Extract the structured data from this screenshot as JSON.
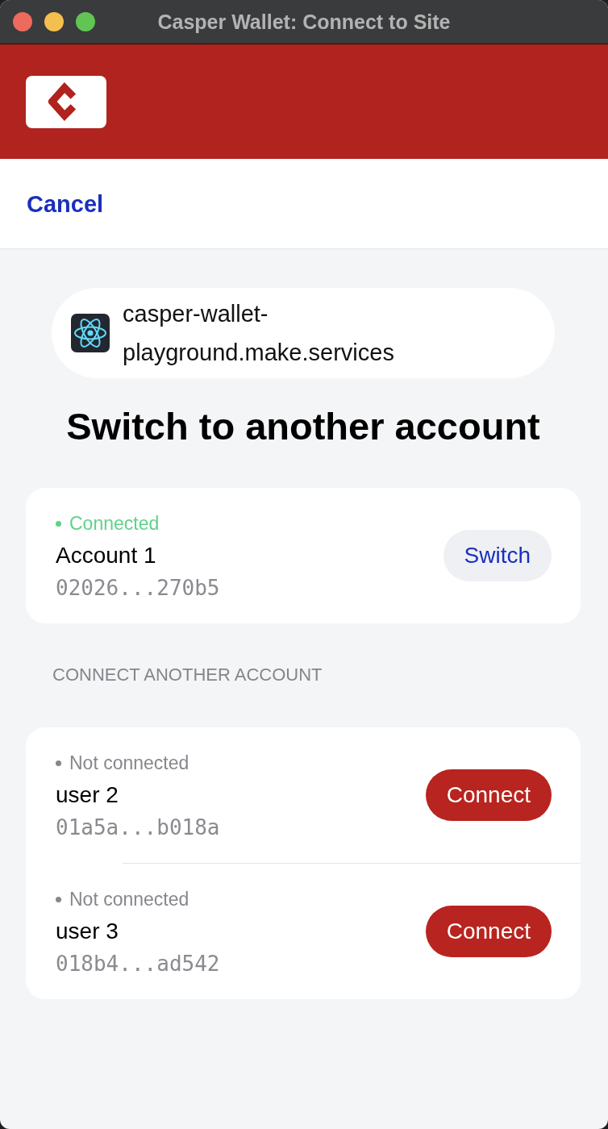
{
  "window": {
    "title": "Casper Wallet: Connect to Site"
  },
  "nav": {
    "cancel": "Cancel"
  },
  "site": {
    "name": "casper-wallet-playground.make.services"
  },
  "heading": "Switch to another account",
  "connected_accounts": [
    {
      "status": "Connected",
      "connected": true,
      "name": "Account 1",
      "key": "02026...270b5",
      "action": "Switch"
    }
  ],
  "other_section": {
    "title": "CONNECT ANOTHER ACCOUNT",
    "accounts": [
      {
        "status": "Not connected",
        "connected": false,
        "name": "user 2",
        "key": "01a5a...b018a",
        "action": "Connect"
      },
      {
        "status": "Not connected",
        "connected": false,
        "name": "user 3",
        "key": "018b4...ad542",
        "action": "Connect"
      }
    ]
  }
}
